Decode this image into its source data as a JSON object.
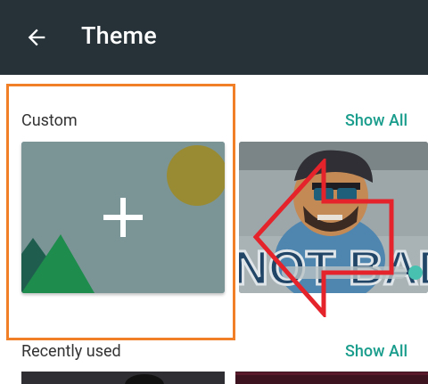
{
  "appbar": {
    "title": "Theme",
    "back_icon": "arrow-back-icon",
    "background": "#263238"
  },
  "sections": [
    {
      "label": "Custom",
      "show_all": "Show All",
      "tiles": [
        {
          "kind": "add-custom-theme",
          "icon": "plus-icon"
        },
        {
          "kind": "image-theme",
          "image": "cartoon character with sunglasses and cap, text NOT BAD"
        }
      ]
    },
    {
      "label": "Recently used",
      "show_all": "Show All"
    }
  ],
  "annotation": {
    "highlight_color": "#f07f27",
    "arrow_color": "#e4232a"
  },
  "accent_color": "#1a9d8c"
}
